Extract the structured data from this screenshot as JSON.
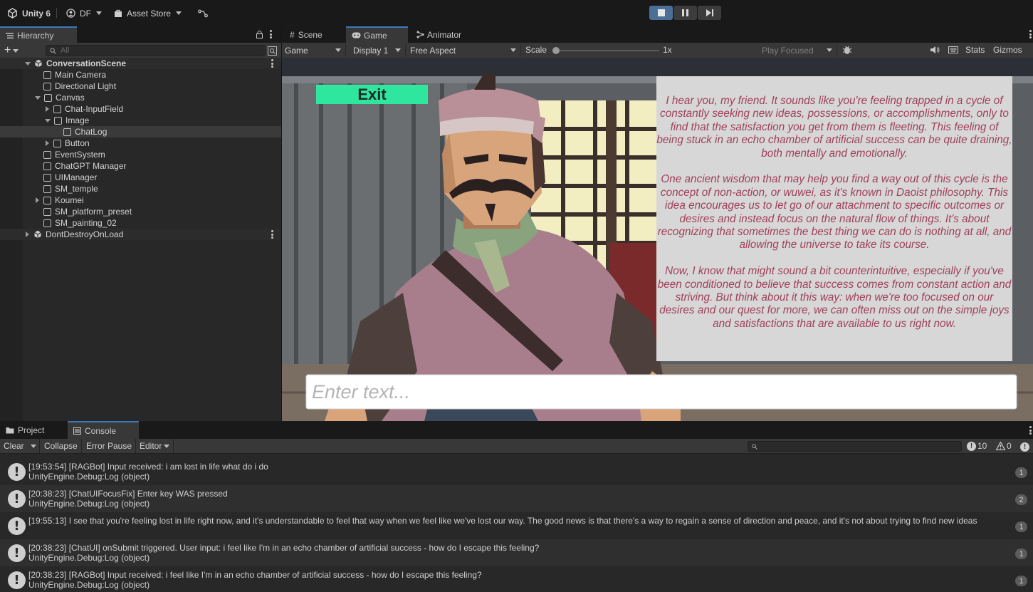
{
  "topbar": {
    "app_title": "Unity 6",
    "account_label": "DF",
    "asset_store_label": "Asset Store"
  },
  "hierarchy": {
    "tab_label": "Hierarchy",
    "search_placeholder": "All",
    "items": [
      {
        "label": "ConversationScene",
        "kind": "scene"
      },
      {
        "label": "Main Camera",
        "kind": "object"
      },
      {
        "label": "Directional Light",
        "kind": "object"
      },
      {
        "label": "Canvas",
        "kind": "object"
      },
      {
        "label": "Chat-InputField",
        "kind": "object"
      },
      {
        "label": "Image",
        "kind": "object"
      },
      {
        "label": "ChatLog",
        "kind": "object"
      },
      {
        "label": "Button",
        "kind": "object"
      },
      {
        "label": "EventSystem",
        "kind": "object"
      },
      {
        "label": "ChatGPT Manager",
        "kind": "object"
      },
      {
        "label": "UIManager",
        "kind": "object"
      },
      {
        "label": "SM_temple",
        "kind": "object"
      },
      {
        "label": "Koumei",
        "kind": "object"
      },
      {
        "label": "SM_platform_preset",
        "kind": "object"
      },
      {
        "label": "SM_painting_02",
        "kind": "object"
      },
      {
        "label": "DontDestroyOnLoad",
        "kind": "scene"
      }
    ]
  },
  "view_tabs": {
    "scene": "Scene",
    "game": "Game",
    "animator": "Animator"
  },
  "game_toolbar": {
    "view_mode": "Game",
    "display": "Display 1",
    "aspect": "Free Aspect",
    "scale_label": "Scale",
    "scale_value": "1x",
    "play_focused": "Play Focused",
    "stats": "Stats",
    "gizmos": "Gizmos"
  },
  "game_view": {
    "exit_label": "Exit",
    "chat_paragraphs": [
      "I hear you, my friend. It sounds like you're feeling trapped in a cycle of constantly seeking new ideas, possessions, or accomplishments, only to find that the satisfaction you get from them is fleeting. This feeling of being stuck in an echo chamber of artificial success can be quite draining, both mentally and emotionally.",
      "One ancient wisdom that may help you find a way out of this cycle is the concept of non-action, or wuwei, as it's known in Daoist philosophy. This idea encourages us to let go of our attachment to specific outcomes or desires and instead focus on the natural flow of things. It's about recognizing that sometimes the best thing we can do is nothing at all, and allowing the universe to take its course.",
      "Now, I know that might sound a bit counterintuitive, especially if you've been conditioned to believe that success comes from constant action and striving. But think about it this way: when we're too focused on our desires and our quest for more, we can often miss out on the simple joys and satisfactions that are available to us right now."
    ],
    "input_placeholder": "Enter text..."
  },
  "bottom_tabs": {
    "project": "Project",
    "console": "Console"
  },
  "console_toolbar": {
    "clear": "Clear",
    "collapse": "Collapse",
    "error_pause": "Error Pause",
    "editor": "Editor",
    "log_count": "10",
    "warn_count": "0"
  },
  "console_logs": [
    {
      "line1": "[19:53:54] [RAGBot] Input received: i am lost in life what do i do",
      "line2": "UnityEngine.Debug:Log (object)",
      "count": "1"
    },
    {
      "line1": "[20:38:23] [ChatUIFocusFix] Enter key WAS pressed",
      "line2": "UnityEngine.Debug:Log (object)",
      "count": "2"
    },
    {
      "line1": "[19:55:13] I see that you're feeling lost in life right now, and it's understandable to feel that way when we feel like we've lost our way. The good news is that there's a way to regain a sense of direction and peace, and it's not about trying to find new ideas",
      "line2": "",
      "count": "1"
    },
    {
      "line1": "[20:38:23] [ChatUI] onSubmit triggered. User input: i feel like I'm in an echo chamber of artificial success - how do I escape this feeling?",
      "line2": "UnityEngine.Debug:Log (object)",
      "count": "1"
    },
    {
      "line1": "[20:38:23] [RAGBot] Input received: i feel like I'm in an echo chamber of artificial success - how do I escape this feeling?",
      "line2": "UnityEngine.Debug:Log (object)",
      "count": "1"
    }
  ],
  "colors": {
    "accent": "#3a79bb",
    "exit_button": "#2ee69e",
    "chat_text": "#a0405a",
    "chat_panel": "#d7d7d7"
  }
}
